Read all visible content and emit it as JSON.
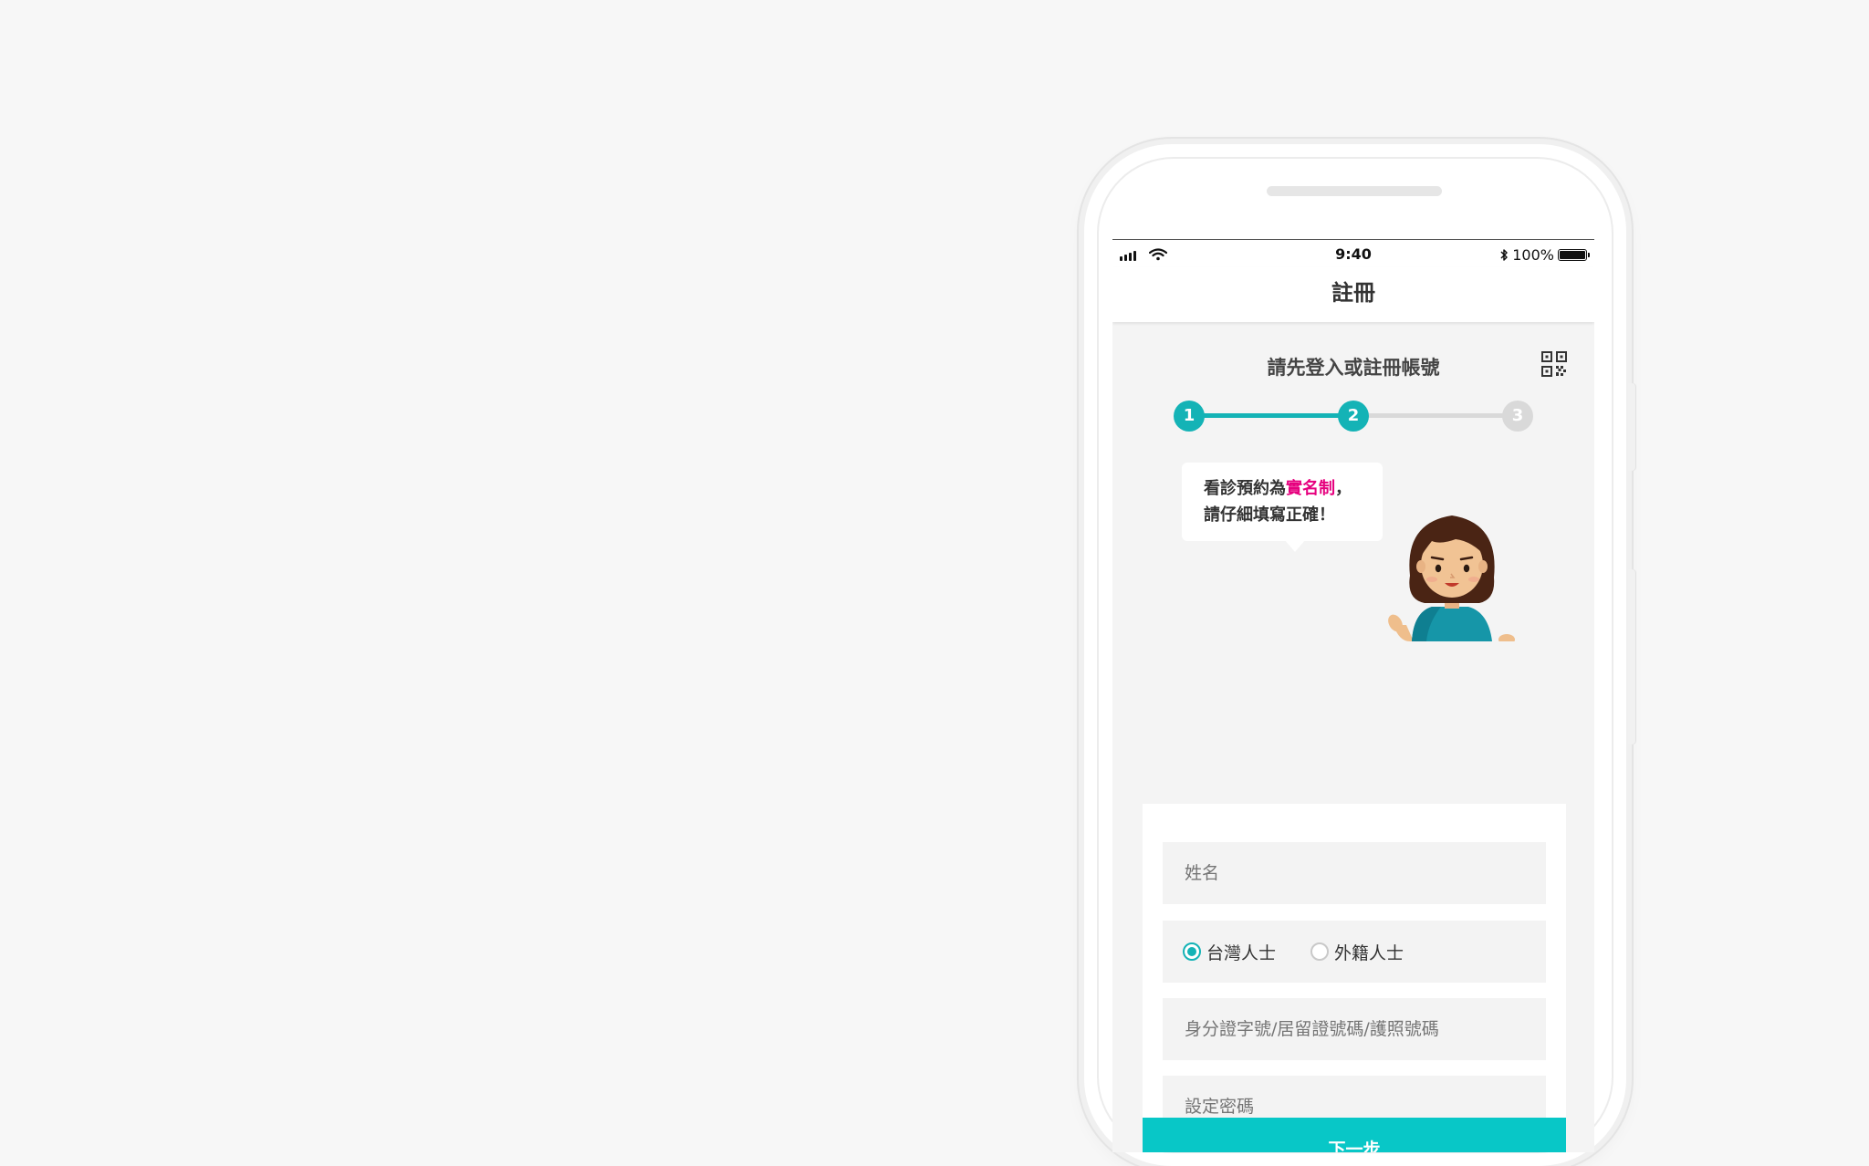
{
  "status_bar": {
    "time": "9:40",
    "battery": "100%"
  },
  "nav": {
    "title": "註冊"
  },
  "prompt": {
    "title": "請先登入或註冊帳號"
  },
  "stepper": {
    "steps": [
      "1",
      "2",
      "3"
    ],
    "current_step": 2
  },
  "bubble": {
    "line1_prefix": "看診預約為",
    "line1_highlight": "實名制",
    "line1_suffix": "，",
    "line2": "請仔細填寫正確！"
  },
  "form": {
    "name_placeholder": "姓名",
    "id_type_options": [
      "台灣人士",
      "外籍人士"
    ],
    "id_type_selected": "台灣人士",
    "id_number_placeholder": "身分證字號/居留證號碼/護照號碼",
    "password_placeholder": "設定密碼",
    "submit_label": "下一步"
  },
  "colors": {
    "accent": "#14b3b6",
    "button": "#08c7c7",
    "highlight": "#e6007e",
    "inactive": "#d9d9d9"
  }
}
